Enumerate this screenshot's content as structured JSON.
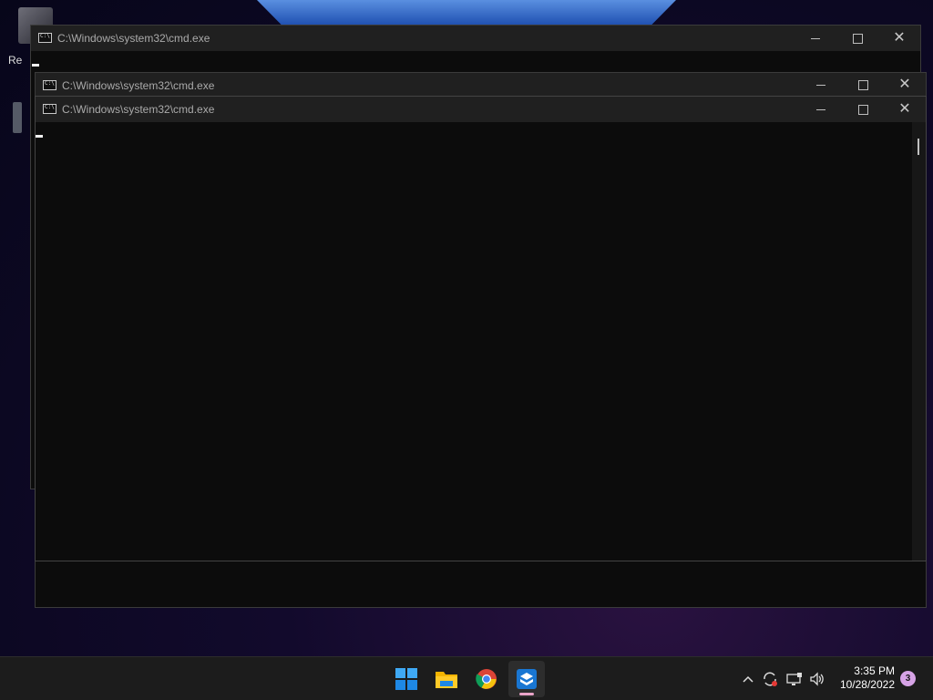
{
  "desktop": {
    "recycle_bin_label": "Re"
  },
  "windows": [
    {
      "title": "C:\\Windows\\system32\\cmd.exe"
    },
    {
      "title": "C:\\Windows\\system32\\cmd.exe"
    },
    {
      "title": "C:\\Windows\\system32\\cmd.exe"
    }
  ],
  "taskbar": {
    "apps": [
      {
        "name": "start-icon"
      },
      {
        "name": "file-explorer-icon"
      },
      {
        "name": "chrome-icon"
      },
      {
        "name": "app-icon"
      }
    ],
    "tray": {
      "time": "3:35 PM",
      "date": "10/28/2022",
      "notification_count": "3"
    }
  }
}
